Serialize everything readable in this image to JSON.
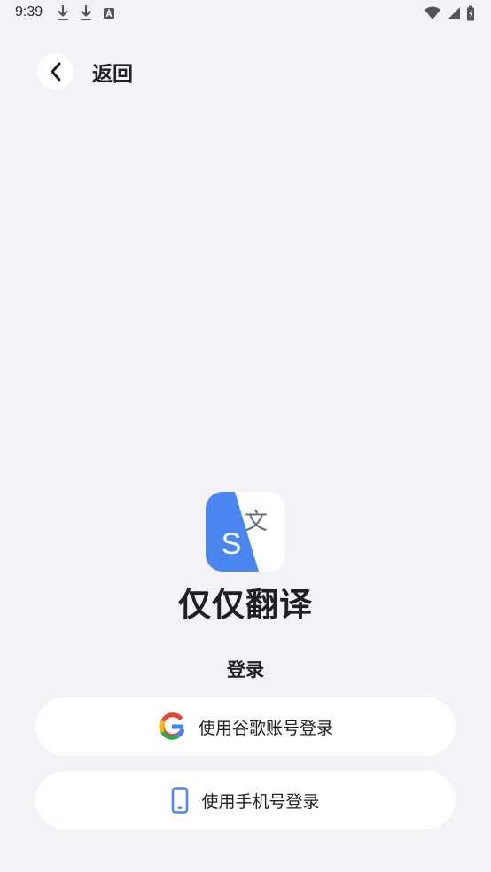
{
  "status_bar": {
    "time": "9:39",
    "left_icons": [
      "download-icon",
      "download-icon",
      "text-a-icon"
    ],
    "right_icons": [
      "wifi-icon",
      "signal-icon",
      "battery-icon"
    ]
  },
  "header": {
    "back_label": "返回"
  },
  "app": {
    "name": "仅仅翻译",
    "logo_letter_s": "S",
    "logo_letter_wen": "文"
  },
  "login": {
    "title": "登录",
    "google_label": "使用谷歌账号登录",
    "phone_label": "使用手机号登录"
  },
  "colors": {
    "background": "#f3f2f7",
    "accent_blue": "#4a86f0",
    "logo_gray": "#5f6b7a"
  }
}
